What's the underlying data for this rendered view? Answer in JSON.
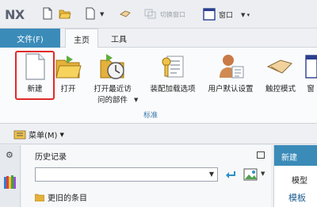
{
  "app": {
    "logo": "NX"
  },
  "quick_access": {
    "switch_window_label": "切换窗口",
    "window_label": "窗口"
  },
  "tabs": {
    "file": "文件(F)",
    "items": [
      "主页",
      "工具"
    ]
  },
  "ribbon": {
    "buttons": {
      "new": "新建",
      "open": "打开",
      "open_recent_line1": "打开最近访",
      "open_recent_line2": "问的部件",
      "assembly_load": "装配加载选项",
      "user_defaults": "用户默认设置",
      "touch_mode": "触控模式",
      "window_partial": "窗"
    },
    "group_label": "标准"
  },
  "menubar": {
    "menu_label": "菜单(M)"
  },
  "history_panel": {
    "title": "历史记录",
    "combo_value": "",
    "older_items": "更旧的条目"
  },
  "new_panel": {
    "title": "新建",
    "tab_model": "模型",
    "tab_template": "模板"
  },
  "colors": {
    "accent": "#3b8bb9",
    "highlight": "#e02a2a"
  }
}
